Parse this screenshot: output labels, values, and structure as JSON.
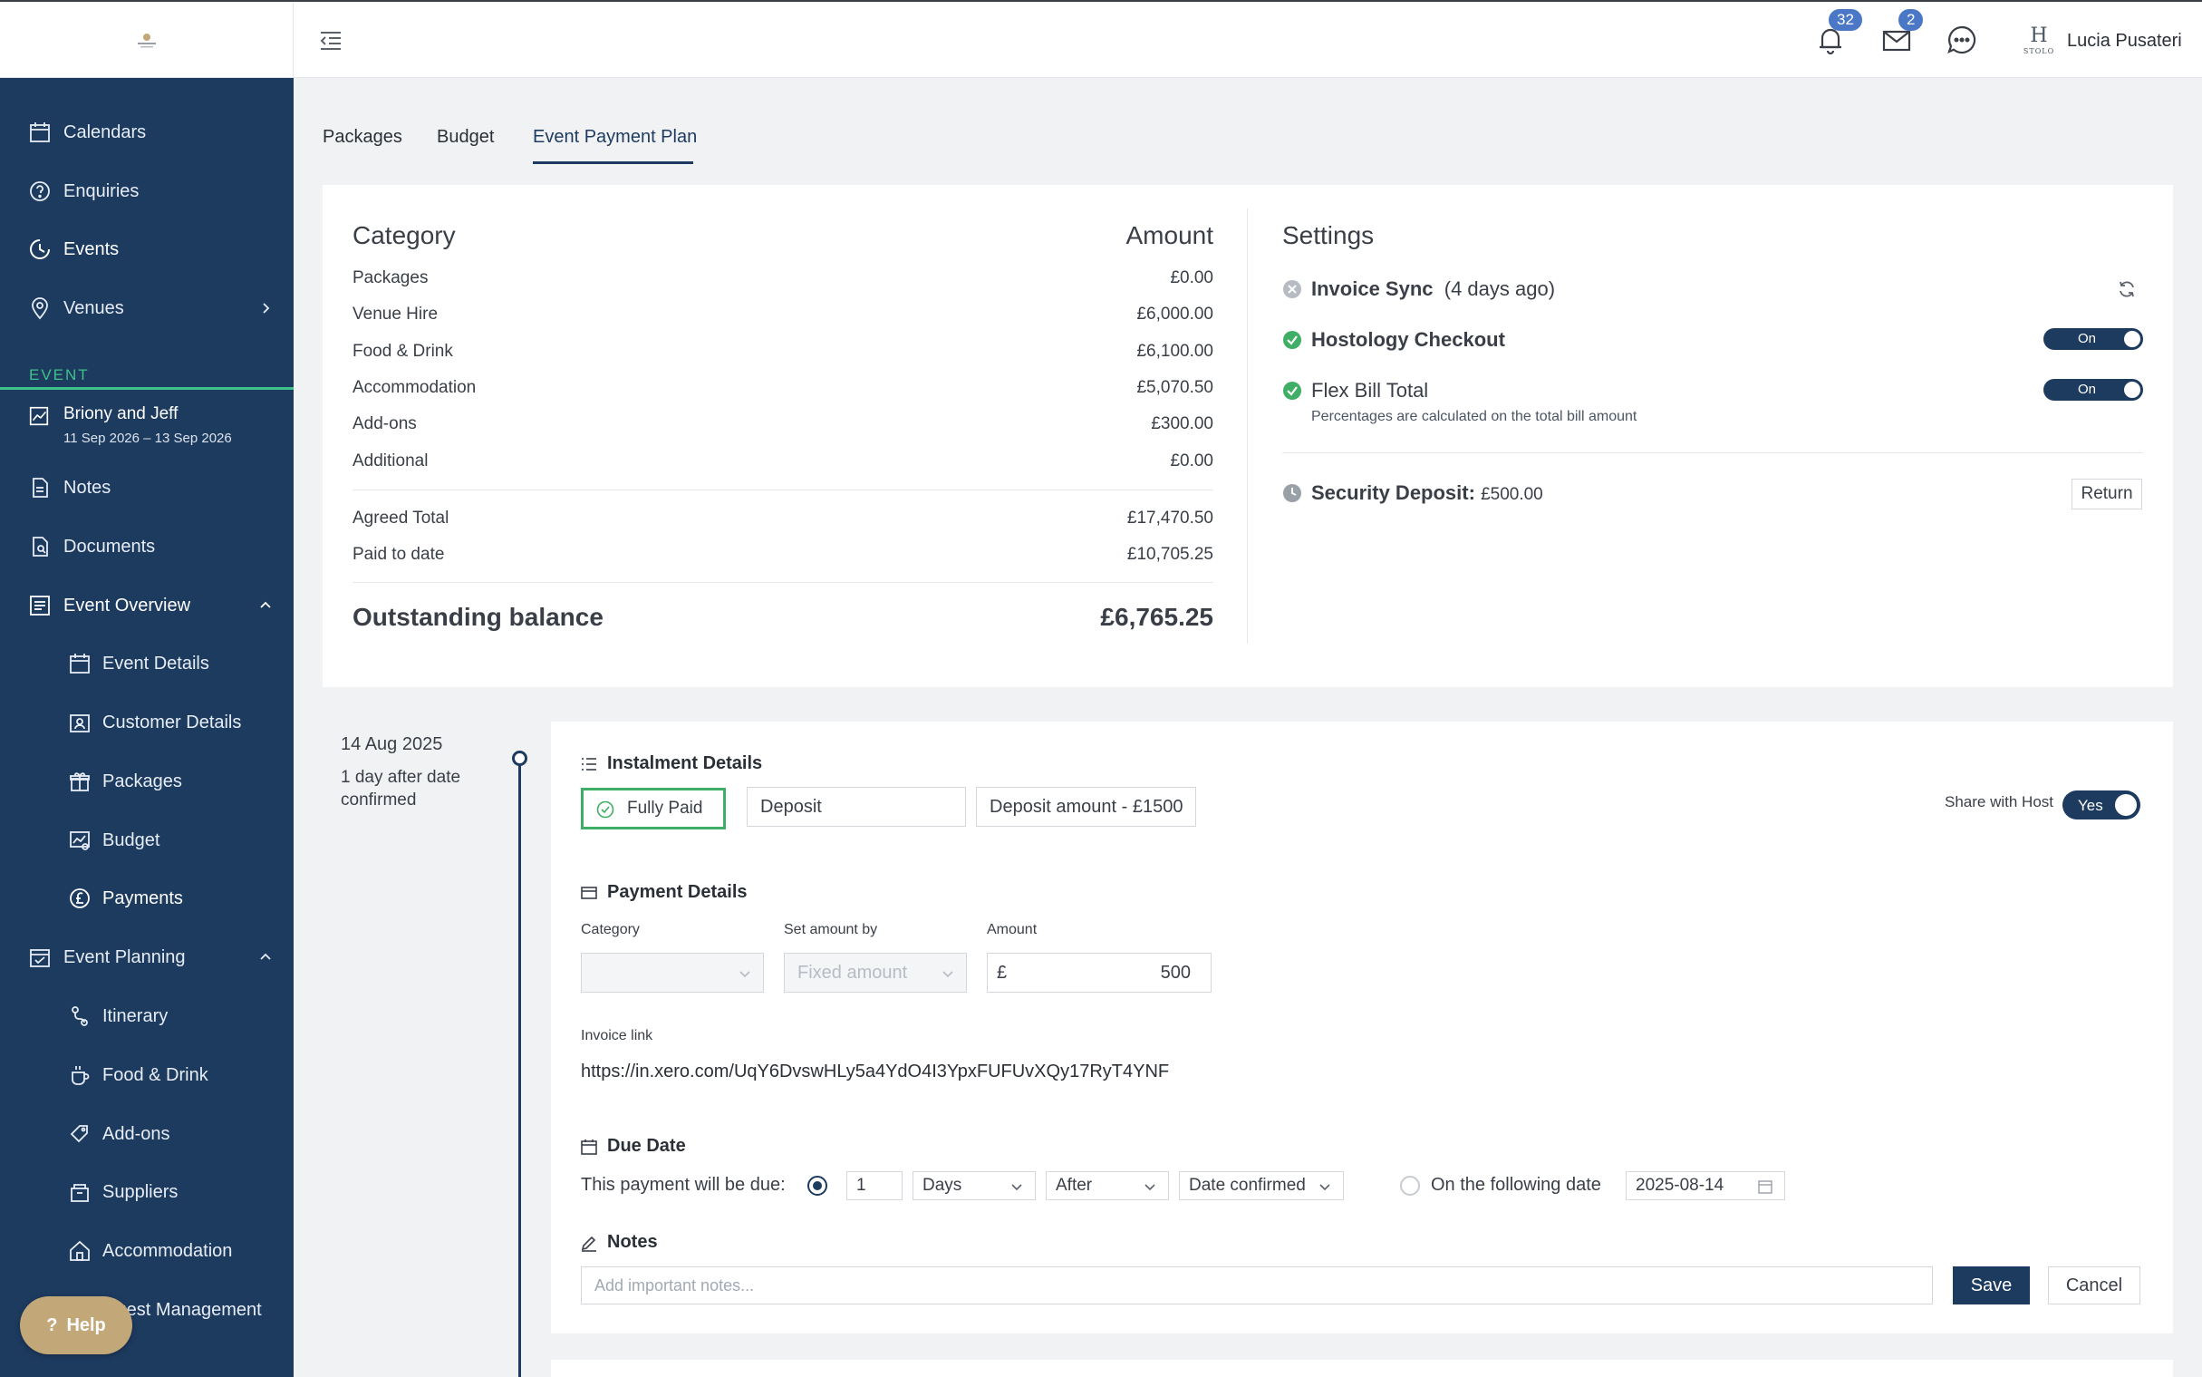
{
  "header": {
    "notification_count": "32",
    "mail_count": "2",
    "user_logo_letter": "H",
    "user_logo_text": "STOLO",
    "user_name": "Lucia Pusateri"
  },
  "sidebar": {
    "items": [
      {
        "label": "Calendars"
      },
      {
        "label": "Enquiries"
      },
      {
        "label": "Events"
      },
      {
        "label": "Venues"
      }
    ],
    "section_label": "EVENT",
    "event": {
      "name": "Briony and Jeff",
      "dates": "11 Sep 2026 – 13 Sep 2026"
    },
    "event_items": [
      {
        "label": "Notes"
      },
      {
        "label": "Documents"
      },
      {
        "label": "Event Overview"
      },
      {
        "label": "Event Details"
      },
      {
        "label": "Customer Details"
      },
      {
        "label": "Packages"
      },
      {
        "label": "Budget"
      },
      {
        "label": "Payments"
      },
      {
        "label": "Event Planning"
      },
      {
        "label": "Itinerary"
      },
      {
        "label": "Food & Drink"
      },
      {
        "label": "Add-ons"
      },
      {
        "label": "Suppliers"
      },
      {
        "label": "Accommodation"
      },
      {
        "label": "Guest Management"
      }
    ],
    "help_label": "Help"
  },
  "tabs": [
    {
      "label": "Packages"
    },
    {
      "label": "Budget"
    },
    {
      "label": "Event Payment Plan"
    }
  ],
  "summary": {
    "category_header": "Category",
    "amount_header": "Amount",
    "rows": [
      {
        "label": "Packages",
        "value": "£0.00"
      },
      {
        "label": "Venue Hire",
        "value": "£6,000.00"
      },
      {
        "label": "Food & Drink",
        "value": "£6,100.00"
      },
      {
        "label": "Accommodation",
        "value": "£5,070.50"
      },
      {
        "label": "Add-ons",
        "value": "£300.00"
      },
      {
        "label": "Additional",
        "value": "£0.00"
      }
    ],
    "agreed_total_label": "Agreed Total",
    "agreed_total": "£17,470.50",
    "paid_label": "Paid to date",
    "paid": "£10,705.25",
    "outstanding_label": "Outstanding balance",
    "outstanding": "£6,765.25"
  },
  "settings": {
    "title": "Settings",
    "invoice_sync": "Invoice Sync",
    "invoice_sync_time": "(4 days ago)",
    "hostology_checkout": "Hostology Checkout",
    "hostology_toggle": "On",
    "flex_bill": "Flex Bill Total",
    "flex_toggle": "On",
    "flex_sub": "Percentages are calculated on the total bill amount",
    "security_deposit_label": "Security Deposit:",
    "security_deposit_value": "£500.00",
    "return_label": "Return"
  },
  "instalment": {
    "date": "14 Aug 2025",
    "note": "1 day after date confirmed",
    "details_title": "Instalment Details",
    "status": "Fully Paid",
    "name": "Deposit",
    "description": "Deposit amount - £1500",
    "share_label": "Share with Host",
    "share_toggle": "Yes",
    "payment_title": "Payment Details",
    "category_label": "Category",
    "category_value": "",
    "set_amount_label": "Set amount by",
    "set_amount_value": "Fixed amount",
    "amount_label": "Amount",
    "currency": "£",
    "amount_value": "500",
    "invoice_link_label": "Invoice link",
    "invoice_link": "https://in.xero.com/UqY6DvswHLy5a4YdO4I3YpxFUFUvXQy17RyT4YNF",
    "due_title": "Due Date",
    "due_text": "This payment will be due:",
    "due_number": "1",
    "due_unit": "Days",
    "due_relation": "After",
    "due_reference": "Date confirmed",
    "following_label": "On the following date",
    "following_date": "2025-08-14",
    "notes_title": "Notes",
    "notes_placeholder": "Add important notes...",
    "save_label": "Save",
    "cancel_label": "Cancel"
  },
  "colors": {
    "sidebar": "#1d3a5f",
    "accent_green": "#3fc18b",
    "badge": "#4a78c7",
    "help": "#c2a878"
  }
}
